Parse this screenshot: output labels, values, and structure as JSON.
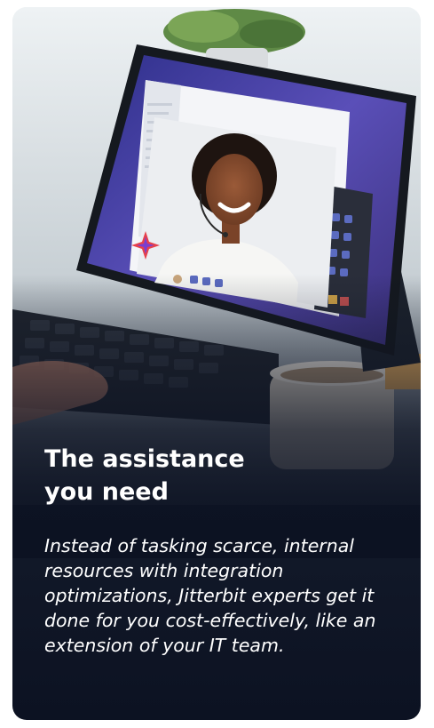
{
  "card": {
    "headline_line1": "The assistance",
    "headline_line2": "you need",
    "body": "Instead of tasking scarce, internal resources with integration optimizations, Jitterbit experts get it done for you cost-effectively, like an extension of your IT team."
  },
  "colors": {
    "card_dark": "#0c1222",
    "text": "#ffffff",
    "screen_purple": "#4b3fa0",
    "brand_star": "#e8404a"
  },
  "icons": [
    "plant-image",
    "tablet-image",
    "person-on-call-image",
    "keyboard-image",
    "coffee-cup-image",
    "hand-image",
    "jitterbit-star-icon"
  ]
}
